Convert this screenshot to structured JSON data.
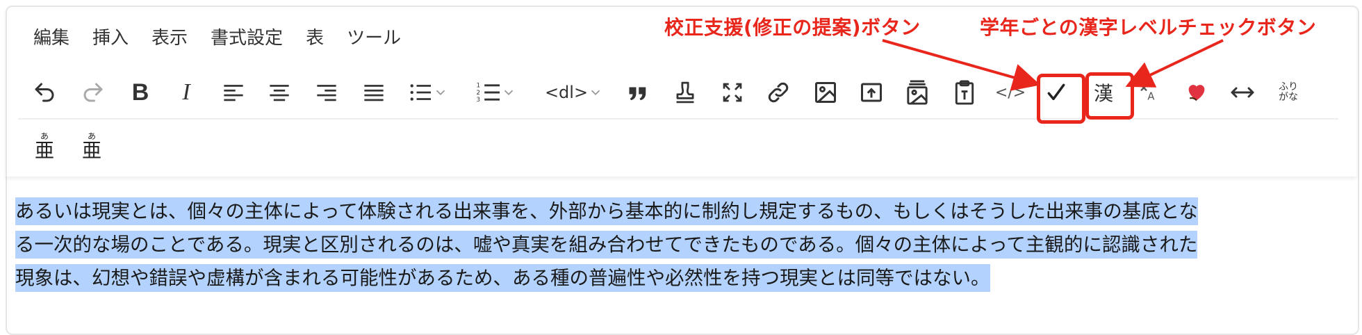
{
  "menu": {
    "items": [
      "編集",
      "挿入",
      "表示",
      "書式設定",
      "表",
      "ツール"
    ]
  },
  "toolbar": {
    "buttons": [
      {
        "name": "undo",
        "icon": "undo-icon"
      },
      {
        "name": "redo",
        "icon": "redo-icon"
      },
      {
        "name": "bold",
        "label": "B",
        "icon": "bold-icon"
      },
      {
        "name": "italic",
        "label": "I",
        "icon": "italic-icon"
      },
      {
        "name": "align-left",
        "icon": "align-left-icon"
      },
      {
        "name": "align-center",
        "icon": "align-center-icon"
      },
      {
        "name": "align-right",
        "icon": "align-right-icon"
      },
      {
        "name": "align-justify",
        "icon": "align-justify-icon"
      },
      {
        "name": "bullet-list",
        "icon": "bullet-list-icon"
      },
      {
        "name": "numbered-list",
        "icon": "numbered-list-icon"
      },
      {
        "name": "definition-list",
        "label": "<dl>"
      },
      {
        "name": "blockquote",
        "icon": "quote-icon"
      },
      {
        "name": "stamp",
        "icon": "stamp-icon"
      },
      {
        "name": "fullscreen",
        "icon": "fullscreen-icon"
      },
      {
        "name": "link",
        "icon": "link-icon"
      },
      {
        "name": "image",
        "icon": "image-icon"
      },
      {
        "name": "upload-image",
        "icon": "upload-image-icon"
      },
      {
        "name": "image-gallery",
        "icon": "image-gallery-icon"
      },
      {
        "name": "paste-text",
        "icon": "paste-text-icon"
      },
      {
        "name": "source-code",
        "label": "</>"
      },
      {
        "name": "proofread",
        "icon": "checkmark-icon"
      },
      {
        "name": "kanji-level",
        "label": "漢"
      },
      {
        "name": "clear-format",
        "icon": "clear-format-icon"
      },
      {
        "name": "favorite",
        "icon": "heart-icon"
      },
      {
        "name": "horizontal-arrows",
        "icon": "horizontal-arrows-icon"
      },
      {
        "name": "furigana",
        "label_top": "ふり",
        "label_bottom": "がな"
      }
    ],
    "row2": [
      {
        "name": "ruby-1",
        "label": "亜",
        "ruby": "あ"
      },
      {
        "name": "ruby-2",
        "label": "亜",
        "ruby": "あ"
      }
    ]
  },
  "annotations": {
    "proofread_label": "校正支援(修正の提案)ボタン",
    "kanji_label": "学年ごとの漢字レベルチェックボタン",
    "color": "#e8261c"
  },
  "content": {
    "lines": [
      "あるいは現実とは、個々の主体によって体験される出来事を、外部から基本的に制約し規定するもの、もしくはそうした出来事の基底とな",
      "る一次的な場のことである。現実と区別されるのは、嘘や真実を組み合わせてできたものである。個々の主体によって主観的に認識された",
      "現象は、幻想や錯誤や虚構が含まれる可能性があるため、ある種の普遍性や必然性を持つ現実とは同等ではない。"
    ],
    "selection_color": "#b3d2fd"
  }
}
